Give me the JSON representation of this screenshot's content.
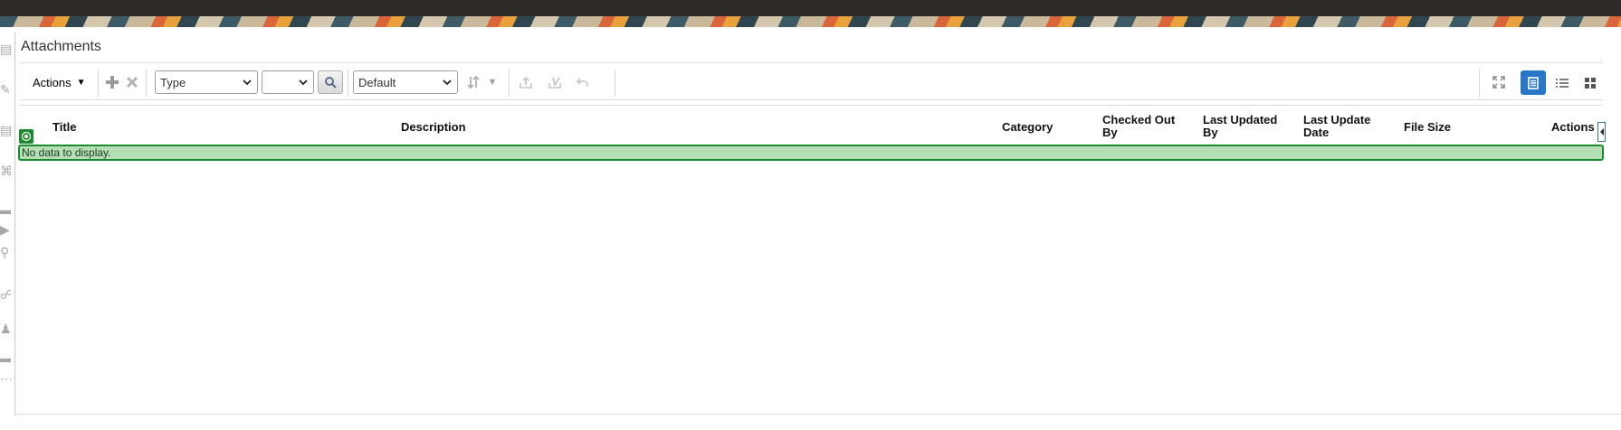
{
  "page": {
    "title": "Attachments"
  },
  "toolbar": {
    "actions_label": "Actions",
    "type_select": {
      "value": "Type"
    },
    "second_select": {
      "value": ""
    },
    "view_select": {
      "value": "Default"
    },
    "active_view": "table"
  },
  "icons": {
    "add": "plus-icon",
    "delete": "close-icon",
    "search": "search-icon",
    "sort": "sort-icon",
    "upload": "upload-icon",
    "checkin": "checkin-icon",
    "undo": "undo-icon",
    "maximize": "expand-icon",
    "table_view": "table-view-icon",
    "list_view": "list-view-icon",
    "grid_view": "grid-view-icon"
  },
  "table": {
    "columns": [
      {
        "key": "title",
        "label": "Title"
      },
      {
        "key": "description",
        "label": "Description"
      },
      {
        "key": "category",
        "label": "Category"
      },
      {
        "key": "checked_out_by",
        "label": "Checked Out By"
      },
      {
        "key": "last_updated_by",
        "label": "Last Updated By"
      },
      {
        "key": "last_update_date",
        "label": "Last Update Date"
      },
      {
        "key": "file_size",
        "label": "File Size"
      },
      {
        "key": "actions",
        "label": "Actions"
      }
    ],
    "empty_message": "No data to display."
  },
  "colors": {
    "accent": "#2a76c6",
    "selection_green": "#1e8a2e",
    "empty_row_bg": "#b4dfb6"
  }
}
